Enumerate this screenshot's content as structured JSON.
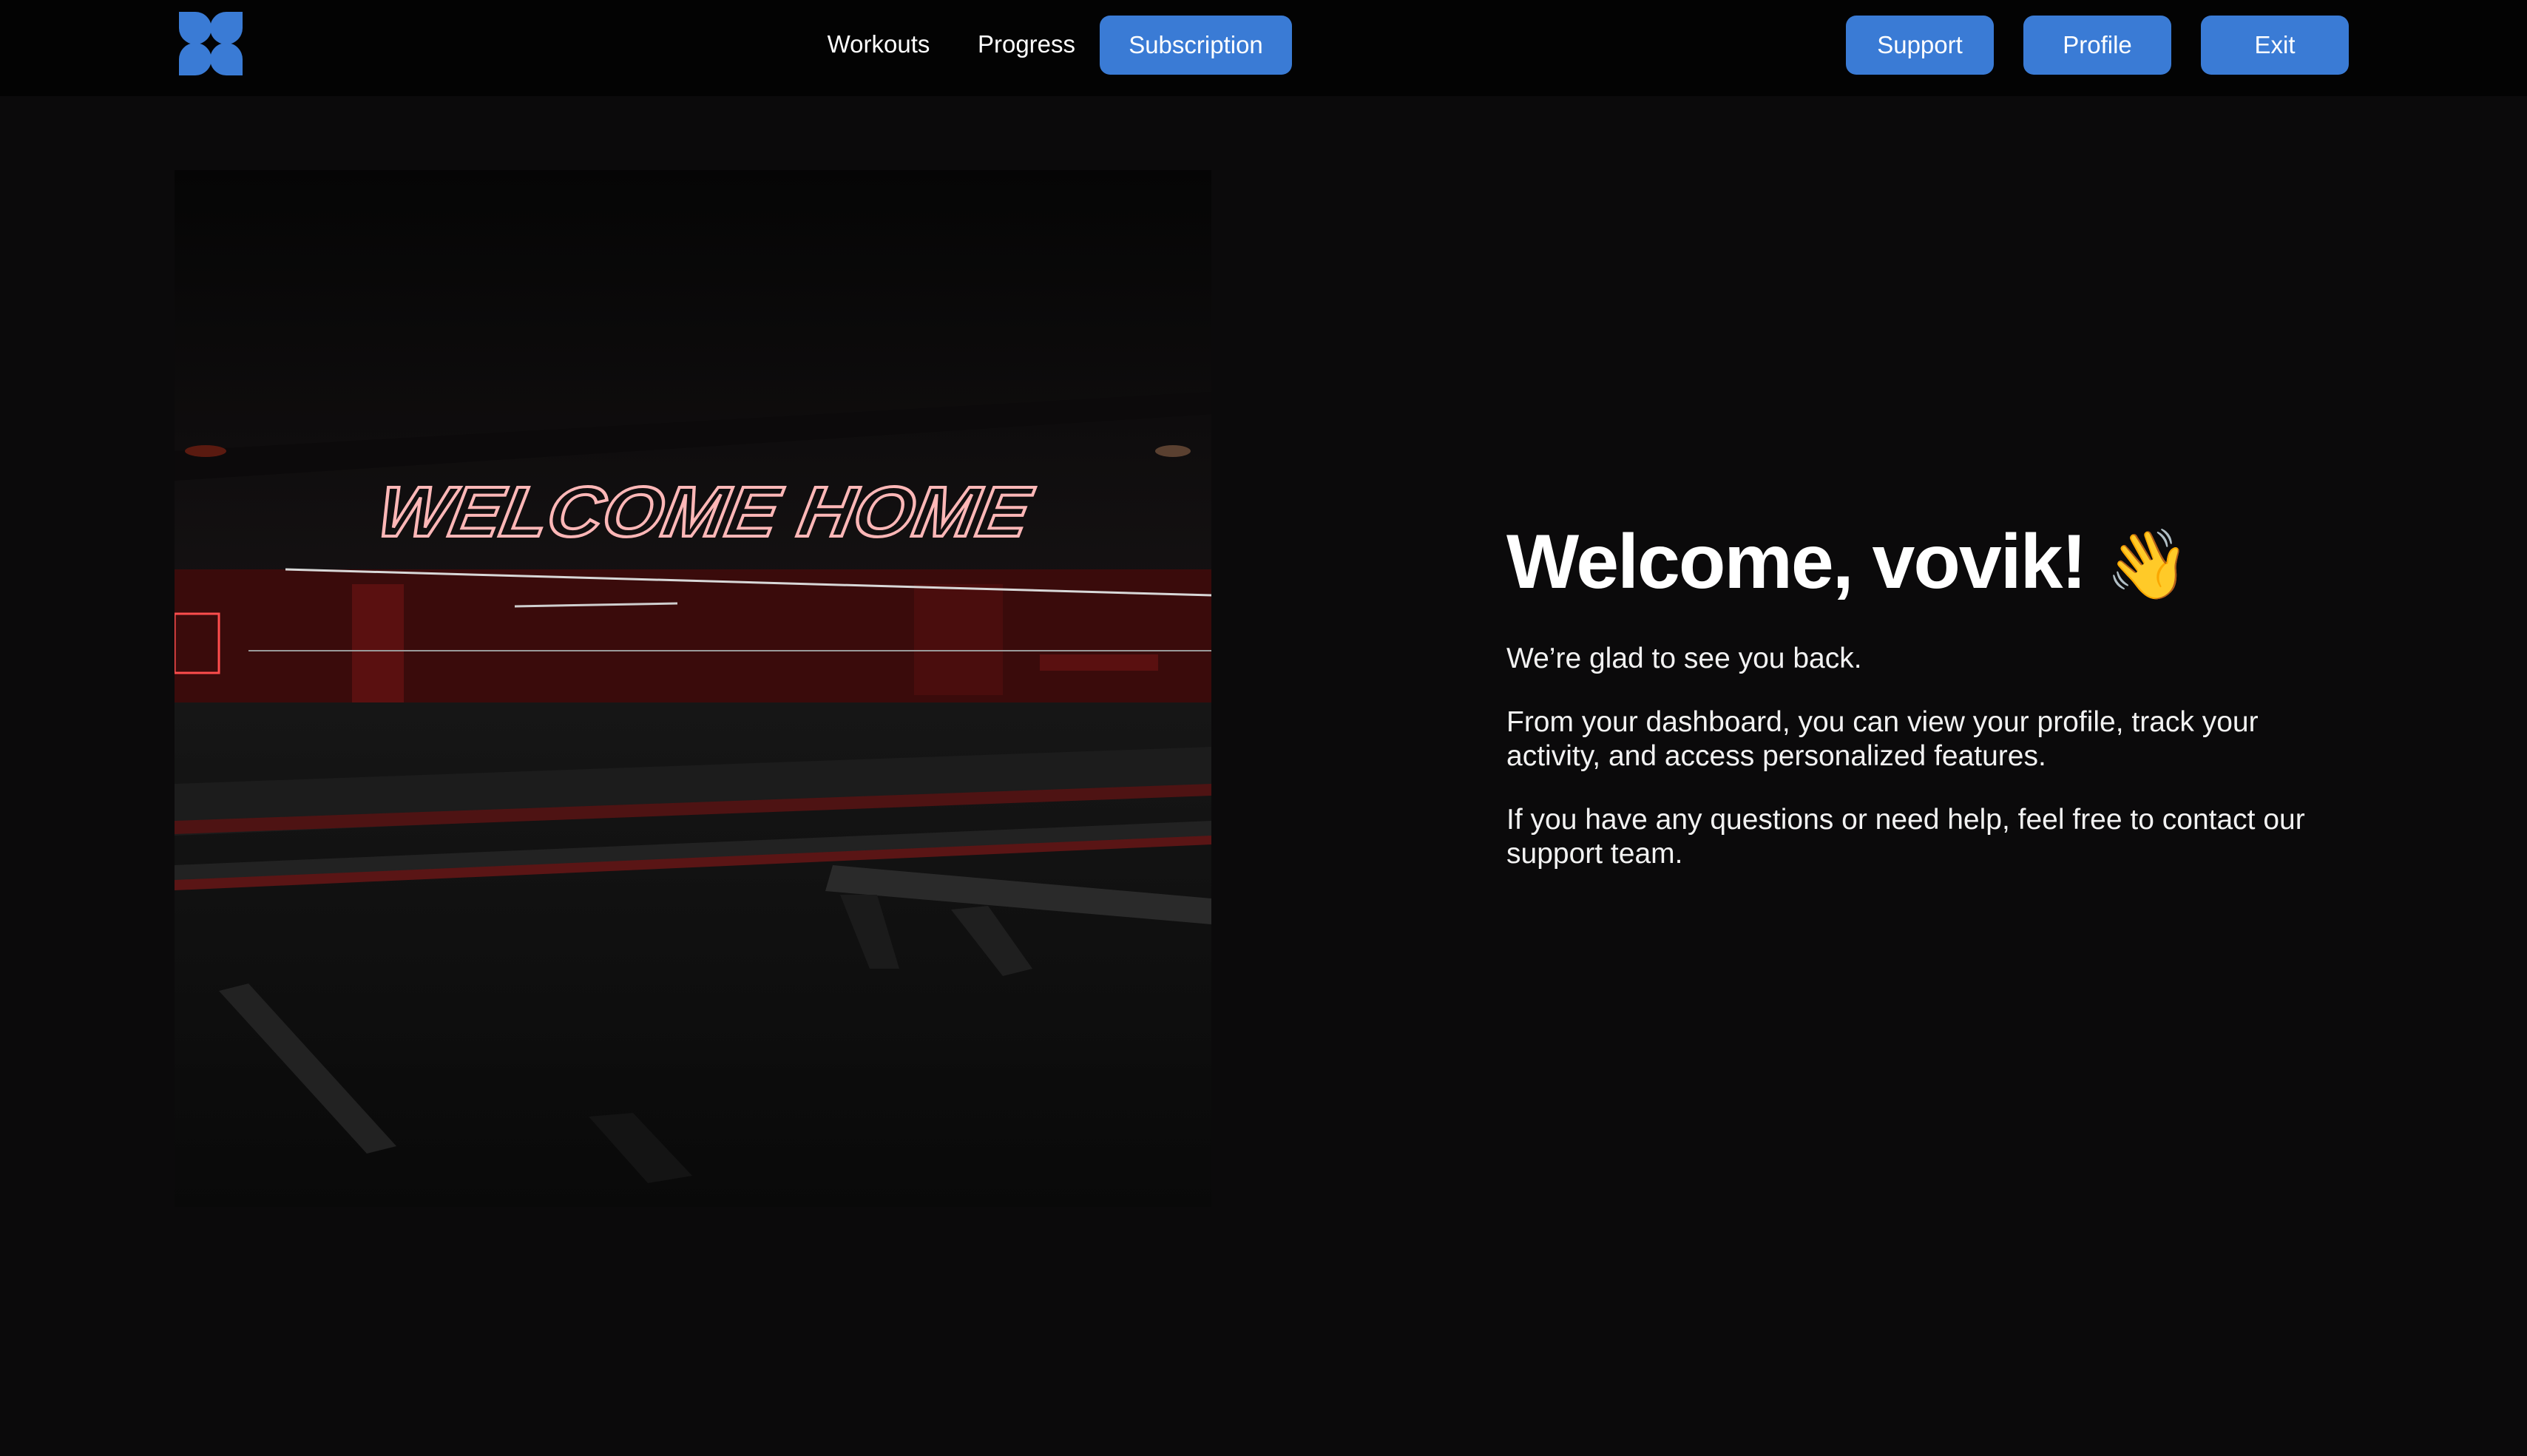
{
  "nav": {
    "links": [
      "Workouts",
      "Progress"
    ],
    "subscription": "Subscription",
    "support": "Support",
    "profile": "Profile",
    "exit": "Exit"
  },
  "hero": {
    "image_icon": "gym-photo",
    "sign_text": "WELCOME HOME"
  },
  "main": {
    "greeting": "Welcome, vovik!",
    "wave_emoji": "👋",
    "paragraphs": [
      "We’re glad to see you back.",
      "From your dashboard, you can view your profile, track your activity, and access personalized features.",
      "If you have any questions or need help, feel free to contact our support team."
    ]
  },
  "colors": {
    "accent": "#3a7bd5",
    "background": "#0b0a0b",
    "topbar": "#030303"
  }
}
